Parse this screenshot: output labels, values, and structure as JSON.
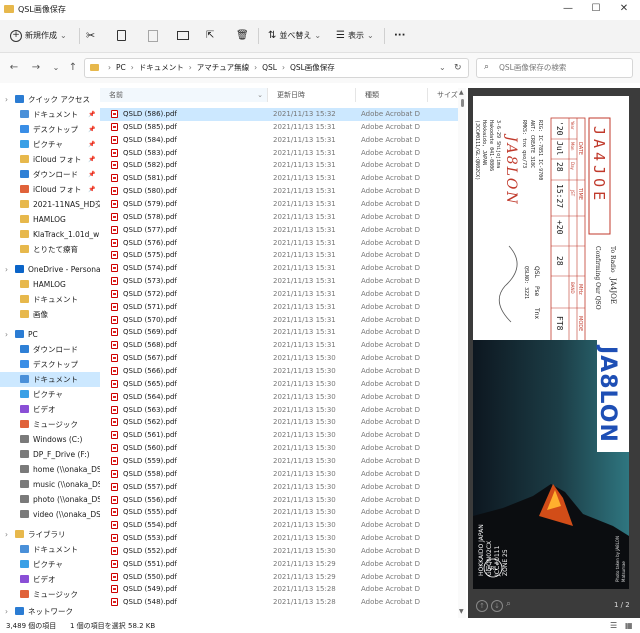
{
  "window": {
    "title": "QSL画像保存"
  },
  "toolbar": {
    "new_label": "新規作成",
    "sort_label": "並べ替え",
    "view_label": "表示",
    "more_label": "···"
  },
  "address": {
    "crumbs": [
      "PC",
      "ドキュメント",
      "アマチュア無線",
      "QSL",
      "QSL画像保存"
    ],
    "search_placeholder": "QSL画像保存の検索"
  },
  "sidebar": {
    "items": [
      {
        "label": "クイック アクセス",
        "icon": "star-icon",
        "color": "#2b7cd3",
        "indent": 0
      },
      {
        "label": "ドキュメント",
        "icon": "document-icon",
        "color": "#4a90d9",
        "indent": 1,
        "pin": "📌"
      },
      {
        "label": "デスクトップ",
        "icon": "desktop-icon",
        "color": "#3a8ee6",
        "indent": 1,
        "pin": "📌"
      },
      {
        "label": "ピクチャ",
        "icon": "pictures-icon",
        "color": "#3aa0e6",
        "indent": 1,
        "pin": "📌"
      },
      {
        "label": "iCloud フォト",
        "icon": "folder-icon",
        "color": "#e7b84c",
        "indent": 1,
        "pin": "📌"
      },
      {
        "label": "ダウンロード",
        "icon": "download-icon",
        "color": "#2f80d6",
        "indent": 1,
        "pin": "📌"
      },
      {
        "label": "iCloud フォト",
        "icon": "icloud-photos-icon",
        "color": "#e0623a",
        "indent": 1,
        "pin": "📌"
      },
      {
        "label": "2021-11NAS_HD交換",
        "icon": "folder-icon",
        "color": "#e7b84c",
        "indent": 1
      },
      {
        "label": "HAMLOG",
        "icon": "folder-icon",
        "color": "#e7b84c",
        "indent": 1
      },
      {
        "label": "KlaTrack_1.01d_win",
        "icon": "folder-icon",
        "color": "#e7b84c",
        "indent": 1
      },
      {
        "label": "とりたて療育",
        "icon": "folder-icon",
        "color": "#e7b84c",
        "indent": 1
      },
      {
        "label": "OneDrive - Personal",
        "icon": "cloud-icon",
        "color": "#0a64c8",
        "indent": 0
      },
      {
        "label": "HAMLOG",
        "icon": "folder-icon",
        "color": "#e7b84c",
        "indent": 1
      },
      {
        "label": "ドキュメント",
        "icon": "folder-icon",
        "color": "#e7b84c",
        "indent": 1
      },
      {
        "label": "画像",
        "icon": "folder-icon",
        "color": "#e7b84c",
        "indent": 1
      },
      {
        "label": "PC",
        "icon": "pc-icon",
        "color": "#2b7cd3",
        "indent": 0
      },
      {
        "label": "ダウンロード",
        "icon": "download-icon",
        "color": "#2f80d6",
        "indent": 1
      },
      {
        "label": "デスクトップ",
        "icon": "desktop-icon",
        "color": "#3a8ee6",
        "indent": 1
      },
      {
        "label": "ドキュメント",
        "icon": "document-icon",
        "color": "#4a90d9",
        "indent": 1,
        "selected": true
      },
      {
        "label": "ピクチャ",
        "icon": "pictures-icon",
        "color": "#3aa0e6",
        "indent": 1
      },
      {
        "label": "ビデオ",
        "icon": "video-icon",
        "color": "#8a4fd6",
        "indent": 1
      },
      {
        "label": "ミュージック",
        "icon": "music-icon",
        "color": "#e0623a",
        "indent": 1
      },
      {
        "label": "Windows (C:)",
        "icon": "drive-icon",
        "color": "#7a7a7a",
        "indent": 1
      },
      {
        "label": "DP_F_Drive (F:)",
        "icon": "drive-icon",
        "color": "#7a7a7a",
        "indent": 1
      },
      {
        "label": "home (\\\\onaka_DS",
        "icon": "network-drive-icon",
        "color": "#7a7a7a",
        "indent": 1
      },
      {
        "label": "music (\\\\onaka_DS",
        "icon": "network-drive-icon",
        "color": "#7a7a7a",
        "indent": 1
      },
      {
        "label": "photo (\\\\onaka_DS",
        "icon": "network-drive-icon",
        "color": "#7a7a7a",
        "indent": 1
      },
      {
        "label": "video (\\\\onaka_DS",
        "icon": "network-drive-icon",
        "color": "#7a7a7a",
        "indent": 1
      },
      {
        "label": "ライブラリ",
        "icon": "library-icon",
        "color": "#e7b84c",
        "indent": 0
      },
      {
        "label": "ドキュメント",
        "icon": "document-icon",
        "color": "#4a90d9",
        "indent": 1
      },
      {
        "label": "ピクチャ",
        "icon": "pictures-icon",
        "color": "#3aa0e6",
        "indent": 1
      },
      {
        "label": "ビデオ",
        "icon": "video-icon",
        "color": "#8a4fd6",
        "indent": 1
      },
      {
        "label": "ミュージック",
        "icon": "music-icon",
        "color": "#e0623a",
        "indent": 1
      },
      {
        "label": "ネットワーク",
        "icon": "network-icon",
        "color": "#2b7cd3",
        "indent": 0
      }
    ]
  },
  "columns": {
    "name": "名前",
    "date": "更新日時",
    "type": "種類",
    "size": "サイズ"
  },
  "files": [
    {
      "name": "QSLD (586).pdf",
      "date": "2021/11/13 15:32",
      "type": "Adobe Acrobat D",
      "selected": true
    },
    {
      "name": "QSLD (585).pdf",
      "date": "2021/11/13 15:31",
      "type": "Adobe Acrobat D"
    },
    {
      "name": "QSLD (584).pdf",
      "date": "2021/11/13 15:31",
      "type": "Adobe Acrobat D"
    },
    {
      "name": "QSLD (583).pdf",
      "date": "2021/11/13 15:31",
      "type": "Adobe Acrobat D"
    },
    {
      "name": "QSLD (582).pdf",
      "date": "2021/11/13 15:31",
      "type": "Adobe Acrobat D"
    },
    {
      "name": "QSLD (581).pdf",
      "date": "2021/11/13 15:31",
      "type": "Adobe Acrobat D"
    },
    {
      "name": "QSLD (580).pdf",
      "date": "2021/11/13 15:31",
      "type": "Adobe Acrobat D"
    },
    {
      "name": "QSLD (579).pdf",
      "date": "2021/11/13 15:31",
      "type": "Adobe Acrobat D"
    },
    {
      "name": "QSLD (578).pdf",
      "date": "2021/11/13 15:31",
      "type": "Adobe Acrobat D"
    },
    {
      "name": "QSLD (577).pdf",
      "date": "2021/11/13 15:31",
      "type": "Adobe Acrobat D"
    },
    {
      "name": "QSLD (576).pdf",
      "date": "2021/11/13 15:31",
      "type": "Adobe Acrobat D"
    },
    {
      "name": "QSLD (575).pdf",
      "date": "2021/11/13 15:31",
      "type": "Adobe Acrobat D"
    },
    {
      "name": "QSLD (574).pdf",
      "date": "2021/11/13 15:31",
      "type": "Adobe Acrobat D"
    },
    {
      "name": "QSLD (573).pdf",
      "date": "2021/11/13 15:31",
      "type": "Adobe Acrobat D"
    },
    {
      "name": "QSLD (572).pdf",
      "date": "2021/11/13 15:31",
      "type": "Adobe Acrobat D"
    },
    {
      "name": "QSLD (571).pdf",
      "date": "2021/11/13 15:31",
      "type": "Adobe Acrobat D"
    },
    {
      "name": "QSLD (570).pdf",
      "date": "2021/11/13 15:31",
      "type": "Adobe Acrobat D"
    },
    {
      "name": "QSLD (569).pdf",
      "date": "2021/11/13 15:31",
      "type": "Adobe Acrobat D"
    },
    {
      "name": "QSLD (568).pdf",
      "date": "2021/11/13 15:31",
      "type": "Adobe Acrobat D"
    },
    {
      "name": "QSLD (567).pdf",
      "date": "2021/11/13 15:30",
      "type": "Adobe Acrobat D"
    },
    {
      "name": "QSLD (566).pdf",
      "date": "2021/11/13 15:30",
      "type": "Adobe Acrobat D"
    },
    {
      "name": "QSLD (565).pdf",
      "date": "2021/11/13 15:30",
      "type": "Adobe Acrobat D"
    },
    {
      "name": "QSLD (564).pdf",
      "date": "2021/11/13 15:30",
      "type": "Adobe Acrobat D"
    },
    {
      "name": "QSLD (563).pdf",
      "date": "2021/11/13 15:30",
      "type": "Adobe Acrobat D"
    },
    {
      "name": "QSLD (562).pdf",
      "date": "2021/11/13 15:30",
      "type": "Adobe Acrobat D"
    },
    {
      "name": "QSLD (561).pdf",
      "date": "2021/11/13 15:30",
      "type": "Adobe Acrobat D"
    },
    {
      "name": "QSLD (560).pdf",
      "date": "2021/11/13 15:30",
      "type": "Adobe Acrobat D"
    },
    {
      "name": "QSLD (559).pdf",
      "date": "2021/11/13 15:30",
      "type": "Adobe Acrobat D"
    },
    {
      "name": "QSLD (558).pdf",
      "date": "2021/11/13 15:30",
      "type": "Adobe Acrobat D"
    },
    {
      "name": "QSLD (557).pdf",
      "date": "2021/11/13 15:30",
      "type": "Adobe Acrobat D"
    },
    {
      "name": "QSLD (556).pdf",
      "date": "2021/11/13 15:30",
      "type": "Adobe Acrobat D"
    },
    {
      "name": "QSLD (555).pdf",
      "date": "2021/11/13 15:30",
      "type": "Adobe Acrobat D"
    },
    {
      "name": "QSLD (554).pdf",
      "date": "2021/11/13 15:30",
      "type": "Adobe Acrobat D"
    },
    {
      "name": "QSLD (553).pdf",
      "date": "2021/11/13 15:30",
      "type": "Adobe Acrobat D"
    },
    {
      "name": "QSLD (552).pdf",
      "date": "2021/11/13 15:30",
      "type": "Adobe Acrobat D"
    },
    {
      "name": "QSLD (551).pdf",
      "date": "2021/11/13 15:29",
      "type": "Adobe Acrobat D"
    },
    {
      "name": "QSLD (550).pdf",
      "date": "2021/11/13 15:29",
      "type": "Adobe Acrobat D"
    },
    {
      "name": "QSLD (549).pdf",
      "date": "2021/11/13 15:28",
      "type": "Adobe Acrobat D"
    },
    {
      "name": "QSLD (548).pdf",
      "date": "2021/11/13 15:28",
      "type": "Adobe Acrobat D"
    }
  ],
  "preview": {
    "callsign_box": "JA4JOE",
    "to_radio": "To Radio",
    "to_call": "JA4JOE",
    "confirming": "Confirming Our QSO",
    "table_headers": [
      "DATE",
      "TIME",
      "MHz",
      "MODE"
    ],
    "date_sub": [
      "Year",
      "Mon",
      "Day"
    ],
    "time_sub": "JST",
    "mhz_sub": "BAND",
    "row": {
      "year": "'20",
      "mon": "Jul",
      "day": "28",
      "time": "15:27",
      "rst": "+20",
      "mhz": "28",
      "mode": "FT8"
    },
    "rig_lines": [
      "RIG: IC-7851 IC-9700",
      "ANT: CREATE 318C",
      "RMKS: tnx qso/73"
    ],
    "qsl_label": "QSL",
    "pse_label": "Pse",
    "tnx_label": "Tnx",
    "qslno": "QSLNO: 3221",
    "station_call": "JA8LON",
    "addr_lines": [
      "3-6-29 Shijojima",
      "Hakodate 041-0806",
      "Hokkaido, JAPAN",
      "(JCC#0111/GL:QN02CX)",
      "OP: Takashi Matsuura"
    ],
    "big_call": "JA8LON",
    "pic_text": [
      "HOKKAIDO JAPAN",
      "GL:QN02CX",
      "JCC#0111",
      "ZONE 25"
    ],
    "photo_credit": "Photo taken by JA8LON",
    "photo_credit2": "Matsumae",
    "jarl_label": "JARL",
    "page_indicator": "1 / 2",
    "colors": {
      "stamp_red": "#c0392b",
      "call_blue": "#1e4fb5",
      "sky_dark": "#0d1720",
      "sky_teal": "#24606a",
      "lava": "#e8541a"
    }
  },
  "status": {
    "count": "3,489 個の項目",
    "selected": "1 個の項目を選択",
    "size": "58.2 KB"
  }
}
